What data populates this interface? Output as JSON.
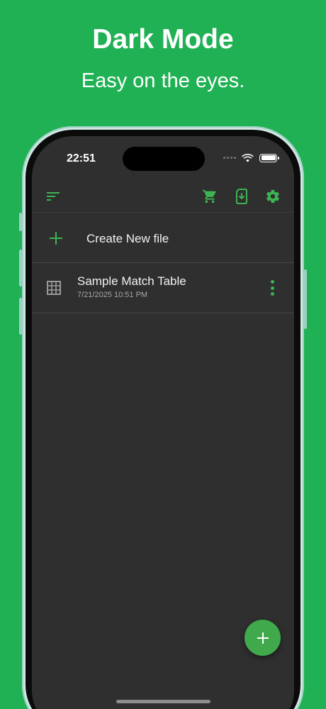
{
  "promo": {
    "title": "Dark Mode",
    "subtitle": "Easy on the eyes."
  },
  "status_bar": {
    "time": "22:51"
  },
  "app_bar": {
    "icons": [
      "sort-menu-icon",
      "cart-icon",
      "file-import-icon",
      "gear-icon"
    ],
    "accent_color": "#3cb452"
  },
  "create_row": {
    "label": "Create New file"
  },
  "files": [
    {
      "name": "Sample Match Table",
      "date": "7/21/2025 10:51 PM"
    }
  ],
  "fab": {
    "icon": "plus-icon"
  },
  "colors": {
    "background": "#1fb153",
    "screen": "#2f2f2f",
    "accent": "#3cb452",
    "text": "#f2f2f2",
    "secondary_text": "#a8a8a8"
  }
}
